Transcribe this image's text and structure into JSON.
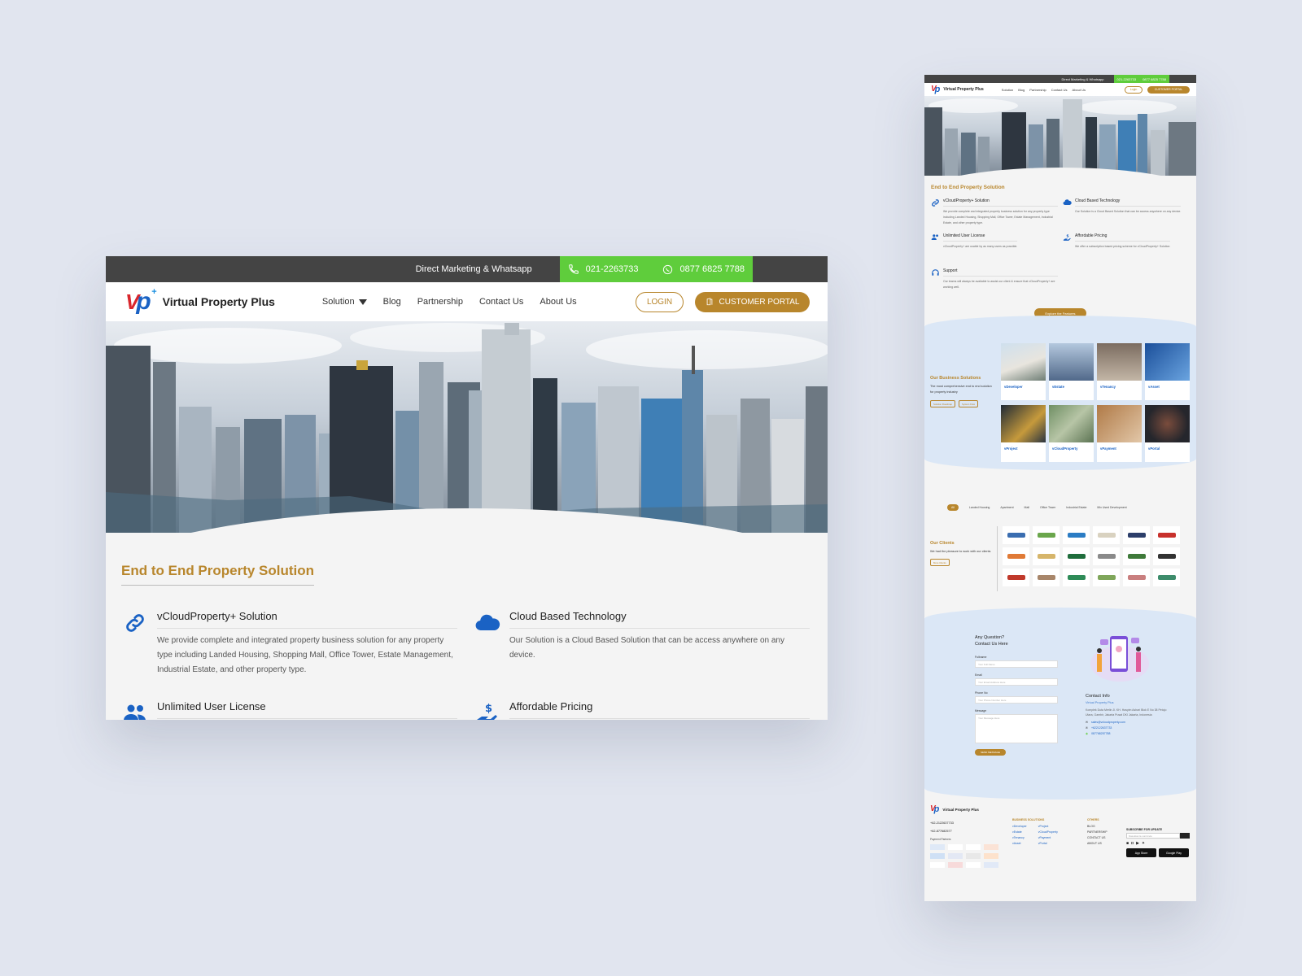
{
  "desktop": {
    "topbar": {
      "label": "Direct Marketing & Whatsapp",
      "phone": "021-2263733",
      "whatsapp": "0877 6825 7788"
    },
    "nav": {
      "brand": "Virtual Property Plus",
      "menu": [
        "Solution",
        "Blog",
        "Partnership",
        "Contact Us",
        "About Us"
      ],
      "login": "LOGIN",
      "portal": "CUSTOMER PORTAL"
    },
    "section_title": "End to End Property Solution",
    "features": [
      {
        "title": "vCloudProperty+ Solution",
        "desc": "We provide complete and integrated property business solution for any property type including Landed Housing, Shopping Mall, Office Tower, Estate Management, Industrial Estate, and other property type.",
        "icon": "link-icon"
      },
      {
        "title": "Cloud Based Technology",
        "desc": "Our Solution is a Cloud Based Solution that can be access anywhere on any device.",
        "icon": "cloud-icon"
      },
      {
        "title": "Unlimited User License",
        "desc": "",
        "icon": "users-icon"
      },
      {
        "title": "Affordable Pricing",
        "desc": "",
        "icon": "hand-dollar-icon"
      }
    ],
    "colors": {
      "gold": "#b8862c",
      "green": "#5fcd3c",
      "blue": "#1a62c4",
      "red": "#d9262c"
    }
  },
  "mobile": {
    "topbar": {
      "label": "Direct Marketing & Whatsapp",
      "phone": "021-2263733",
      "whatsapp": "0877 6825 7788"
    },
    "nav": {
      "brand": "Virtual Property Plus",
      "menu": [
        "Solution",
        "Blog",
        "Partnership",
        "Contact Us",
        "About Us"
      ],
      "login": "Login",
      "portal": "CUSTOMER PORTAL"
    },
    "section_title": "End to End Property Solution",
    "features": [
      {
        "title": "vCloudProperty+ Solution",
        "desc": "We provide complete and integrated property business solution for any property type including Landed Housing, Shopping Mall, Office Tower, Estate Management, Industrial Estate, and other property type."
      },
      {
        "title": "Cloud Based Technology",
        "desc": "Our Solution is a Cloud Based Solution that can be access anywhere on any device."
      },
      {
        "title": "Unlimited User License",
        "desc": "vCloudProperty+ are usable by as many users as possible."
      },
      {
        "title": "Affordable Pricing",
        "desc": "We offer a subscription based pricing scheme for vCloudProperty+ Solution"
      },
      {
        "title": "Support",
        "desc": "Our teams will always be available to assist our client & ensure that vCloudProperty+ are working well."
      }
    ],
    "explore": "Explore the Features",
    "solutions": {
      "title": "Our Business Solutions",
      "desc": "The most comprehensive end to end solution for property industry",
      "buttons": [
        "Solution Roadmap",
        "System Flow"
      ],
      "items": [
        "vDeveloper",
        "vEstate",
        "vTenancy",
        "vAsset",
        "vProject",
        "vCloudProperty",
        "vPayment",
        "vPortal"
      ]
    },
    "client_tabs": [
      "All",
      "Landed Housing",
      "Apartment",
      "Mall",
      "Office Tower",
      "Industrial Estate",
      "Mix Used Development"
    ],
    "clients": {
      "title": "Our Clients",
      "desc": "We had the pleasure to work with our clients",
      "button": "More Clients"
    },
    "contact": {
      "heading": [
        "Any Question?",
        "Contact Us Here"
      ],
      "fields": [
        {
          "label": "Fullname",
          "placeholder": "Your Full Name"
        },
        {
          "label": "Email",
          "placeholder": "Your Email Address Here"
        },
        {
          "label": "Phone No",
          "placeholder": "Your Phone Number Here"
        },
        {
          "label": "Message",
          "placeholder": "Your Message Here"
        }
      ],
      "send": "SEND MESSAGE",
      "info_title": "Contact Info",
      "info_company": "Virtual Property Plus",
      "info_address": "Komplek Duta Merlin Jl. KH. Hasyim Ashari Blok E No 38 Petojo Utara, Gambir, Jakarta Pusat DKI Jakarta, Indonesia",
      "info_email": "sales@vcloudproperty.com",
      "info_phone": "+622122637733",
      "info_whatsapp": "087768257788"
    },
    "footer": {
      "brand": "Virtual Property Plus",
      "phone": "+62-2122637733",
      "whatsapp": "+62-877682577",
      "payment_label": "Payment Partners",
      "biz_title": "BUSINESS SOLUTIONS",
      "biz_col1": [
        "vDeveloper",
        "vEstate",
        "vTenancy",
        "vAsset"
      ],
      "biz_col2": [
        "vProject",
        "vCloudProperty",
        "vPayment",
        "vPortal"
      ],
      "others_title": "OTHERS",
      "others": [
        "BLOG",
        "PARTNERSHIP",
        "CONTACT US",
        "ABOUT US"
      ],
      "subscribe_title": "SUBSCRIBE FOR UPDATE",
      "subscribe_placeholder": "Masukkan E-mail Anda",
      "app_store": "App Store",
      "google_play": "Google Play"
    }
  }
}
